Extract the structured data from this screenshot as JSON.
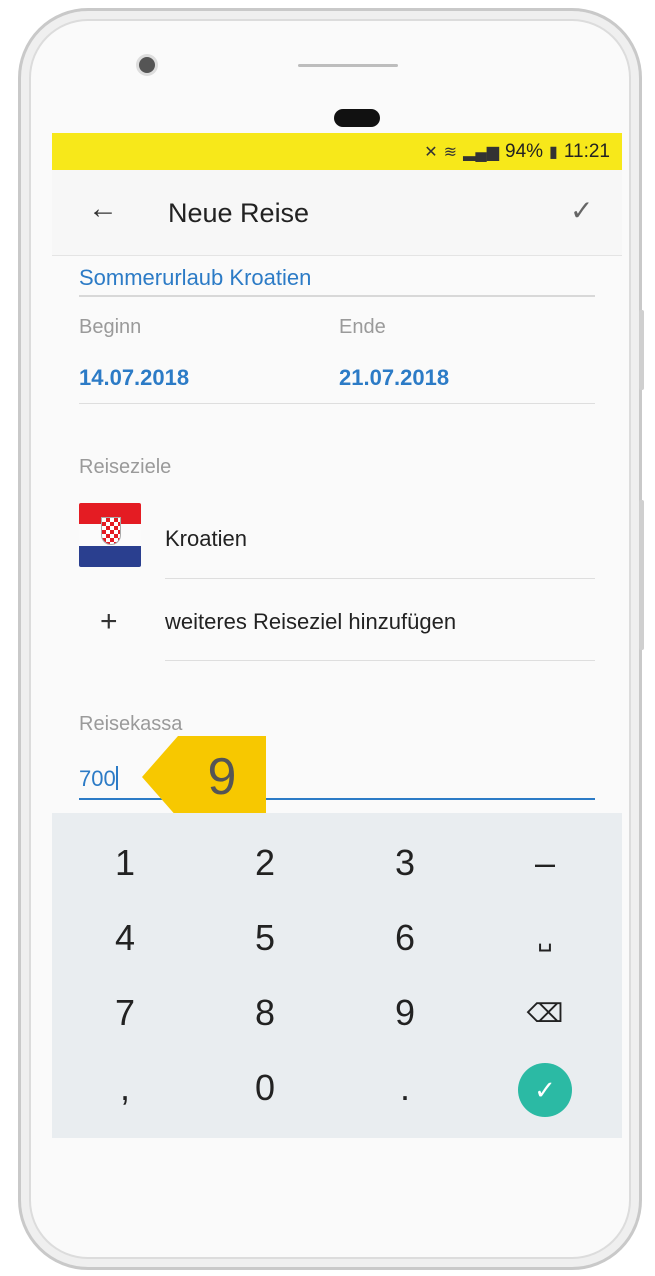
{
  "status_bar": {
    "battery": "94%",
    "time": "11:21",
    "signal_icon": "signal-icon",
    "wifi_icon": "wifi-icon",
    "mute_icon": "mute-icon",
    "battery_icon": "battery-icon"
  },
  "appbar": {
    "title": "Neue Reise",
    "back_icon": "←",
    "confirm_icon": "✓"
  },
  "form": {
    "trip_name": "Sommerurlaub Kroatien",
    "begin_label": "Beginn",
    "begin_value": "14.07.2018",
    "end_label": "Ende",
    "end_value": "21.07.2018",
    "destinations_label": "Reiseziele",
    "destinations": [
      {
        "name": "Kroatien",
        "flag_icon": "croatia-flag-icon"
      }
    ],
    "add_destination_icon": "+",
    "add_destination_label": "weiteres Reiseziel hinzufügen",
    "budget_label": "Reisekassa",
    "budget_value": "700"
  },
  "annotation": {
    "step_number": "9"
  },
  "keyboard": {
    "keys": [
      "1",
      "2",
      "3",
      "–",
      "4",
      "5",
      "6",
      "␣",
      "7",
      "8",
      "9",
      "⌫",
      ",",
      "0",
      "."
    ],
    "enter_icon": "✓"
  },
  "colors": {
    "accent": "#2c7bc6",
    "statusbar": "#f7e81a",
    "annotation": "#f7c800",
    "enter": "#2bbaa4"
  }
}
